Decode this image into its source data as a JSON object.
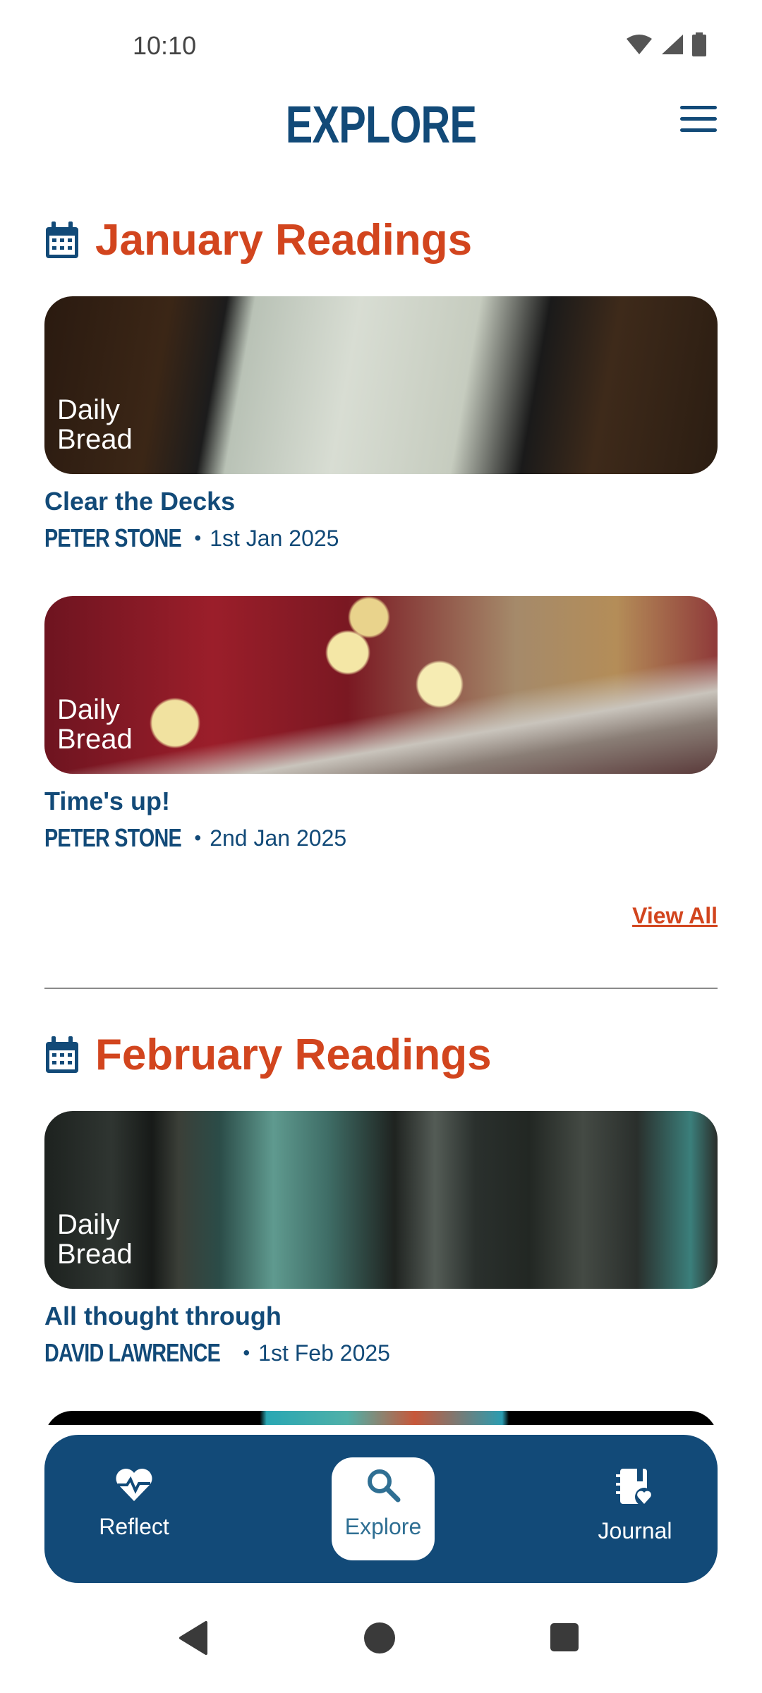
{
  "status": {
    "time": "10:10"
  },
  "header": {
    "title": "EXPLORE"
  },
  "sections": [
    {
      "title": "January Readings",
      "cards": [
        {
          "badge_line1": "Daily",
          "badge_line2": "Bread",
          "title": "Clear the Decks",
          "author": "PETER STONE",
          "date": "1st Jan 2025"
        },
        {
          "badge_line1": "Daily",
          "badge_line2": "Bread",
          "title": "Time's up!",
          "author": "PETER STONE",
          "date": "2nd Jan 2025"
        }
      ],
      "view_all": "View All"
    },
    {
      "title": "February Readings",
      "cards": [
        {
          "badge_line1": "Daily",
          "badge_line2": "Bread",
          "title": "All thought through",
          "author": "DAVID LAWRENCE",
          "date": "1st Feb 2025"
        }
      ]
    }
  ],
  "bottom_nav": {
    "items": [
      {
        "label": "Reflect",
        "icon": "heart-pulse-icon",
        "active": false
      },
      {
        "label": "Explore",
        "icon": "search-icon",
        "active": true
      },
      {
        "label": "Journal",
        "icon": "journal-heart-icon",
        "active": false
      }
    ]
  },
  "colors": {
    "primary": "#124a78",
    "accent": "#d2451e",
    "background": "#ffffff"
  },
  "meta_separator": "•"
}
